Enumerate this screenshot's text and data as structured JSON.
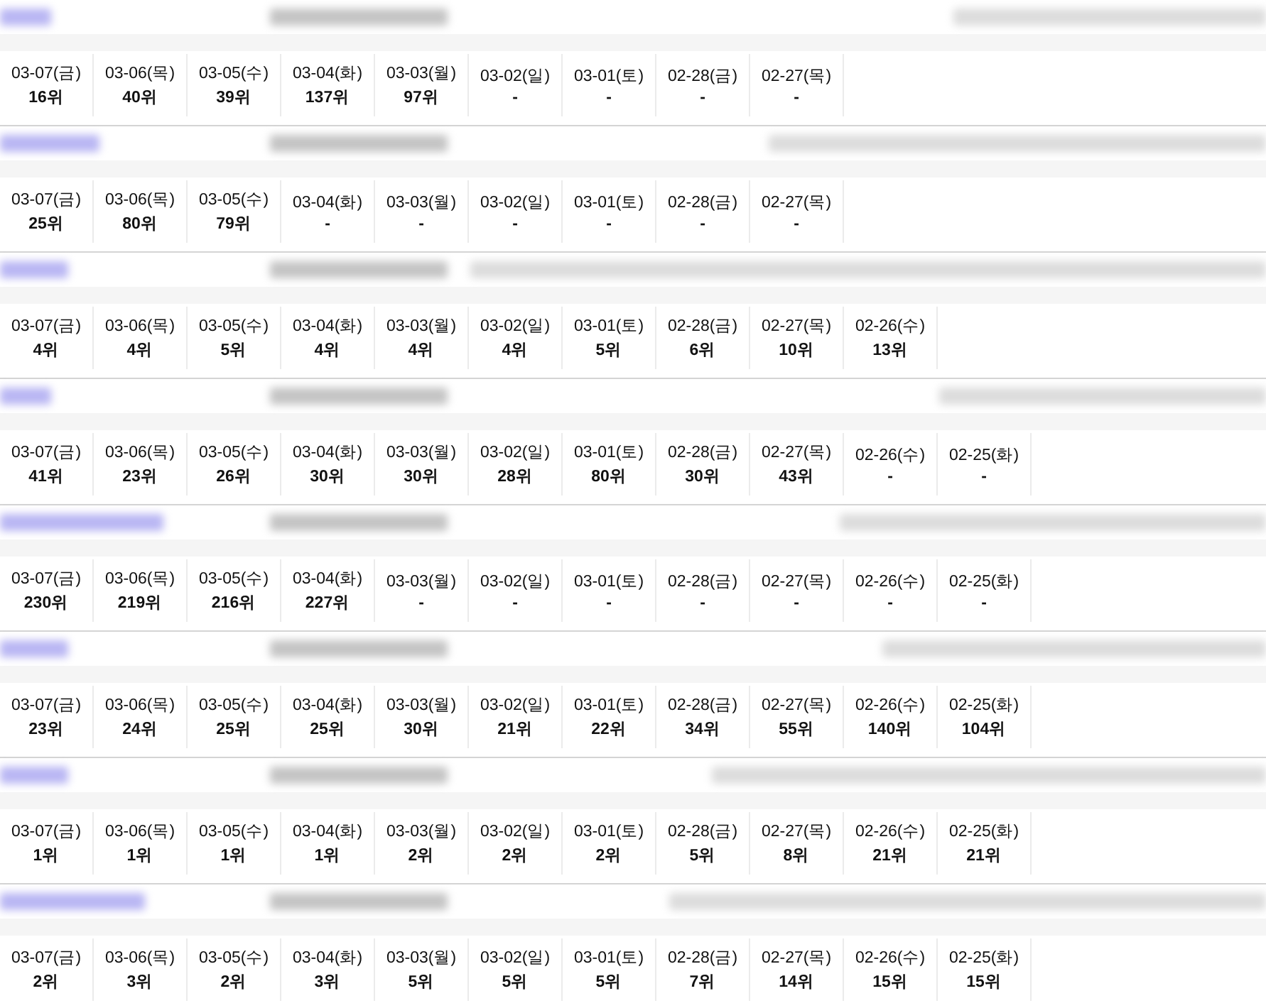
{
  "items": [
    {
      "ranks": [
        {
          "date": "03-07(금)",
          "rank": "16위"
        },
        {
          "date": "03-06(목)",
          "rank": "40위"
        },
        {
          "date": "03-05(수)",
          "rank": "39위"
        },
        {
          "date": "03-04(화)",
          "rank": "137위"
        },
        {
          "date": "03-03(월)",
          "rank": "97위"
        },
        {
          "date": "03-02(일)",
          "rank": "-"
        },
        {
          "date": "03-01(토)",
          "rank": "-"
        },
        {
          "date": "02-28(금)",
          "rank": "-"
        },
        {
          "date": "02-27(목)",
          "rank": "-"
        }
      ]
    },
    {
      "ranks": [
        {
          "date": "03-07(금)",
          "rank": "25위"
        },
        {
          "date": "03-06(목)",
          "rank": "80위"
        },
        {
          "date": "03-05(수)",
          "rank": "79위"
        },
        {
          "date": "03-04(화)",
          "rank": "-"
        },
        {
          "date": "03-03(월)",
          "rank": "-"
        },
        {
          "date": "03-02(일)",
          "rank": "-"
        },
        {
          "date": "03-01(토)",
          "rank": "-"
        },
        {
          "date": "02-28(금)",
          "rank": "-"
        },
        {
          "date": "02-27(목)",
          "rank": "-"
        }
      ]
    },
    {
      "ranks": [
        {
          "date": "03-07(금)",
          "rank": "4위"
        },
        {
          "date": "03-06(목)",
          "rank": "4위"
        },
        {
          "date": "03-05(수)",
          "rank": "5위"
        },
        {
          "date": "03-04(화)",
          "rank": "4위"
        },
        {
          "date": "03-03(월)",
          "rank": "4위"
        },
        {
          "date": "03-02(일)",
          "rank": "4위"
        },
        {
          "date": "03-01(토)",
          "rank": "5위"
        },
        {
          "date": "02-28(금)",
          "rank": "6위"
        },
        {
          "date": "02-27(목)",
          "rank": "10위"
        },
        {
          "date": "02-26(수)",
          "rank": "13위"
        }
      ]
    },
    {
      "ranks": [
        {
          "date": "03-07(금)",
          "rank": "41위"
        },
        {
          "date": "03-06(목)",
          "rank": "23위"
        },
        {
          "date": "03-05(수)",
          "rank": "26위"
        },
        {
          "date": "03-04(화)",
          "rank": "30위"
        },
        {
          "date": "03-03(월)",
          "rank": "30위"
        },
        {
          "date": "03-02(일)",
          "rank": "28위"
        },
        {
          "date": "03-01(토)",
          "rank": "80위"
        },
        {
          "date": "02-28(금)",
          "rank": "30위"
        },
        {
          "date": "02-27(목)",
          "rank": "43위"
        },
        {
          "date": "02-26(수)",
          "rank": "-"
        },
        {
          "date": "02-25(화)",
          "rank": "-"
        }
      ]
    },
    {
      "ranks": [
        {
          "date": "03-07(금)",
          "rank": "230위"
        },
        {
          "date": "03-06(목)",
          "rank": "219위"
        },
        {
          "date": "03-05(수)",
          "rank": "216위"
        },
        {
          "date": "03-04(화)",
          "rank": "227위"
        },
        {
          "date": "03-03(월)",
          "rank": "-"
        },
        {
          "date": "03-02(일)",
          "rank": "-"
        },
        {
          "date": "03-01(토)",
          "rank": "-"
        },
        {
          "date": "02-28(금)",
          "rank": "-"
        },
        {
          "date": "02-27(목)",
          "rank": "-"
        },
        {
          "date": "02-26(수)",
          "rank": "-"
        },
        {
          "date": "02-25(화)",
          "rank": "-"
        }
      ]
    },
    {
      "ranks": [
        {
          "date": "03-07(금)",
          "rank": "23위"
        },
        {
          "date": "03-06(목)",
          "rank": "24위"
        },
        {
          "date": "03-05(수)",
          "rank": "25위"
        },
        {
          "date": "03-04(화)",
          "rank": "25위"
        },
        {
          "date": "03-03(월)",
          "rank": "30위"
        },
        {
          "date": "03-02(일)",
          "rank": "21위"
        },
        {
          "date": "03-01(토)",
          "rank": "22위"
        },
        {
          "date": "02-28(금)",
          "rank": "34위"
        },
        {
          "date": "02-27(목)",
          "rank": "55위"
        },
        {
          "date": "02-26(수)",
          "rank": "140위"
        },
        {
          "date": "02-25(화)",
          "rank": "104위"
        }
      ]
    },
    {
      "ranks": [
        {
          "date": "03-07(금)",
          "rank": "1위"
        },
        {
          "date": "03-06(목)",
          "rank": "1위"
        },
        {
          "date": "03-05(수)",
          "rank": "1위"
        },
        {
          "date": "03-04(화)",
          "rank": "1위"
        },
        {
          "date": "03-03(월)",
          "rank": "2위"
        },
        {
          "date": "03-02(일)",
          "rank": "2위"
        },
        {
          "date": "03-01(토)",
          "rank": "2위"
        },
        {
          "date": "02-28(금)",
          "rank": "5위"
        },
        {
          "date": "02-27(목)",
          "rank": "8위"
        },
        {
          "date": "02-26(수)",
          "rank": "21위"
        },
        {
          "date": "02-25(화)",
          "rank": "21위"
        }
      ]
    },
    {
      "ranks": [
        {
          "date": "03-07(금)",
          "rank": "2위"
        },
        {
          "date": "03-06(목)",
          "rank": "3위"
        },
        {
          "date": "03-05(수)",
          "rank": "2위"
        },
        {
          "date": "03-04(화)",
          "rank": "3위"
        },
        {
          "date": "03-03(월)",
          "rank": "5위"
        },
        {
          "date": "03-02(일)",
          "rank": "5위"
        },
        {
          "date": "03-01(토)",
          "rank": "5위"
        },
        {
          "date": "02-28(금)",
          "rank": "7위"
        },
        {
          "date": "02-27(목)",
          "rank": "14위"
        },
        {
          "date": "02-26(수)",
          "rank": "15위"
        },
        {
          "date": "02-25(화)",
          "rank": "15위"
        }
      ]
    }
  ]
}
